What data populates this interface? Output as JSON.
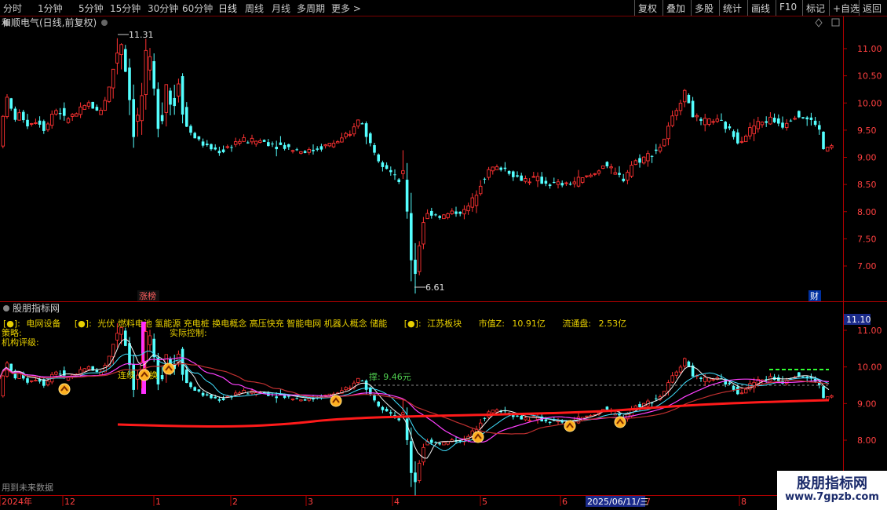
{
  "toolbar": {
    "periods": [
      "分时",
      "1分钟",
      "5分钟",
      "15分钟",
      "30分钟",
      "60分钟",
      "日线",
      "周线",
      "月线",
      "多周期",
      "更多 >"
    ],
    "active_period": "日线",
    "right_buttons": [
      "复权",
      "叠加",
      "多股",
      "统计",
      "画线",
      "F10",
      "标记",
      "+自选",
      "返回"
    ]
  },
  "main_chart": {
    "title": "和顺电气(日线,前复权)",
    "high_label": "11.31",
    "low_label": "6.61",
    "y_ticks": [
      "11.00",
      "10.50",
      "10.00",
      "9.50",
      "9.00",
      "8.50",
      "8.00",
      "7.50",
      "7.00"
    ],
    "tag_left": "涨榜",
    "tag_right": "财",
    "colors": {
      "up": "#ff3232",
      "down": "#54ffff",
      "axis": "#b00000"
    }
  },
  "indicator_panel": {
    "title": "股朋指标网",
    "value_box": "11.10",
    "line1": {
      "dot1": "[●]:",
      "industry": "电网设备",
      "dot2": "[●]:",
      "concepts": "光伏 燃料电池 氢能源 充电桩 换电概念 高压快充 智能电网 机器人概念 储能",
      "dot3": "[●]:",
      "region": "江苏板块",
      "market_cap_label": "市值Z:",
      "market_cap_value": "10.91亿",
      "float_cap_label": "流通盘:",
      "float_cap_value": "2.53亿"
    },
    "strategy_label": "策略:",
    "rating_label": "机构评级:",
    "control_label": "实际控制:",
    "lianban_label": "连续",
    "huan_label": "换",
    "support_label": "撑: 9.46元",
    "y_ticks": [
      "11.00",
      "10.00",
      "9.00",
      "8.00"
    ],
    "footer_text": "用到未来数据"
  },
  "time_axis": {
    "labels": [
      "2024年",
      "12",
      "1",
      "2",
      "3",
      "4",
      "5",
      "6",
      "7",
      "8"
    ],
    "highlight": "2025/06/11/三"
  },
  "watermark": {
    "title": "股朋指标网",
    "url": "www.7gpzb.com"
  }
}
